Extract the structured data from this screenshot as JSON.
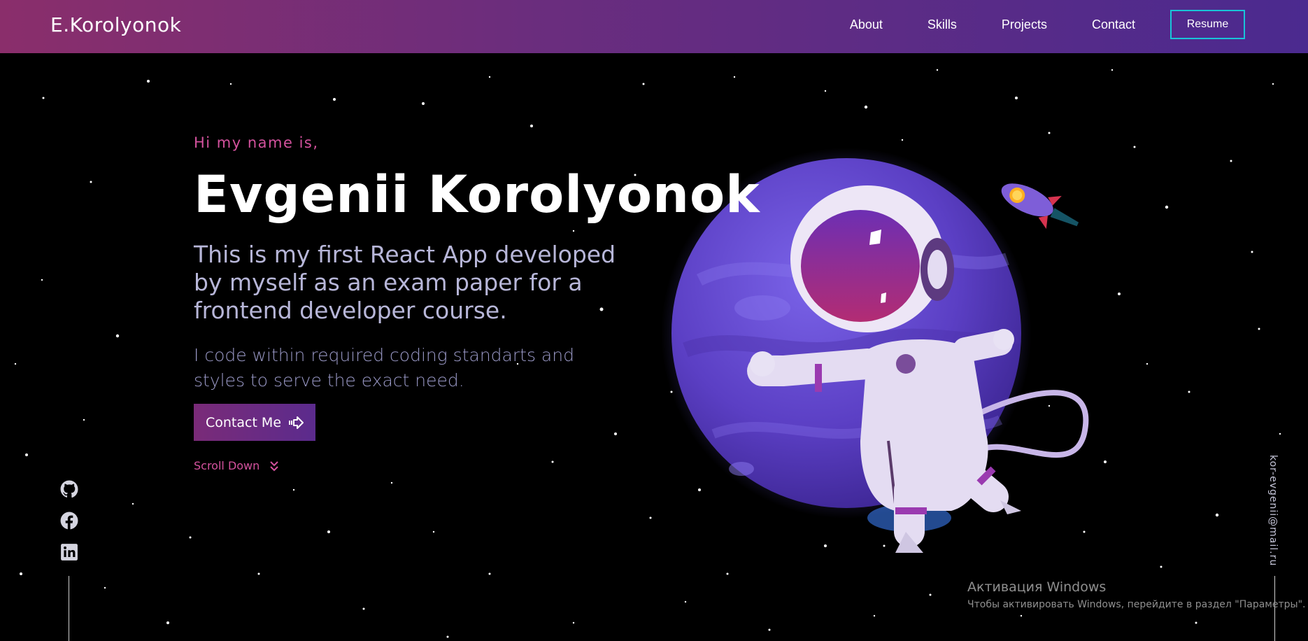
{
  "header": {
    "brand": "E.Korolyonok",
    "nav": [
      "About",
      "Skills",
      "Projects",
      "Contact"
    ],
    "resume_label": "Resume"
  },
  "hero": {
    "greeting": "Hi my name is,",
    "name": "Evgenii Korolyonok",
    "tagline": "This is my first React App developed by myself as an exam paper for a frontend developer course.",
    "subtext": "I code within required coding standarts and styles to serve the exact need.",
    "contact_label": "Contact Me",
    "scroll_label": "Scroll Down"
  },
  "socials": [
    "github-icon",
    "facebook-icon",
    "linkedin-icon"
  ],
  "email": "kor-evgenii@mail.ru",
  "watermark": {
    "title": "Активация Windows",
    "subtitle": "Чтобы активировать Windows, перейдите в раздел \"Параметры\"."
  },
  "colors": {
    "header_left": "#8a2e6b",
    "header_right": "#4b2a8f",
    "accent_pink": "#d4529e",
    "resume_border": "#19c4d8",
    "planet": "#6a4fd0"
  }
}
